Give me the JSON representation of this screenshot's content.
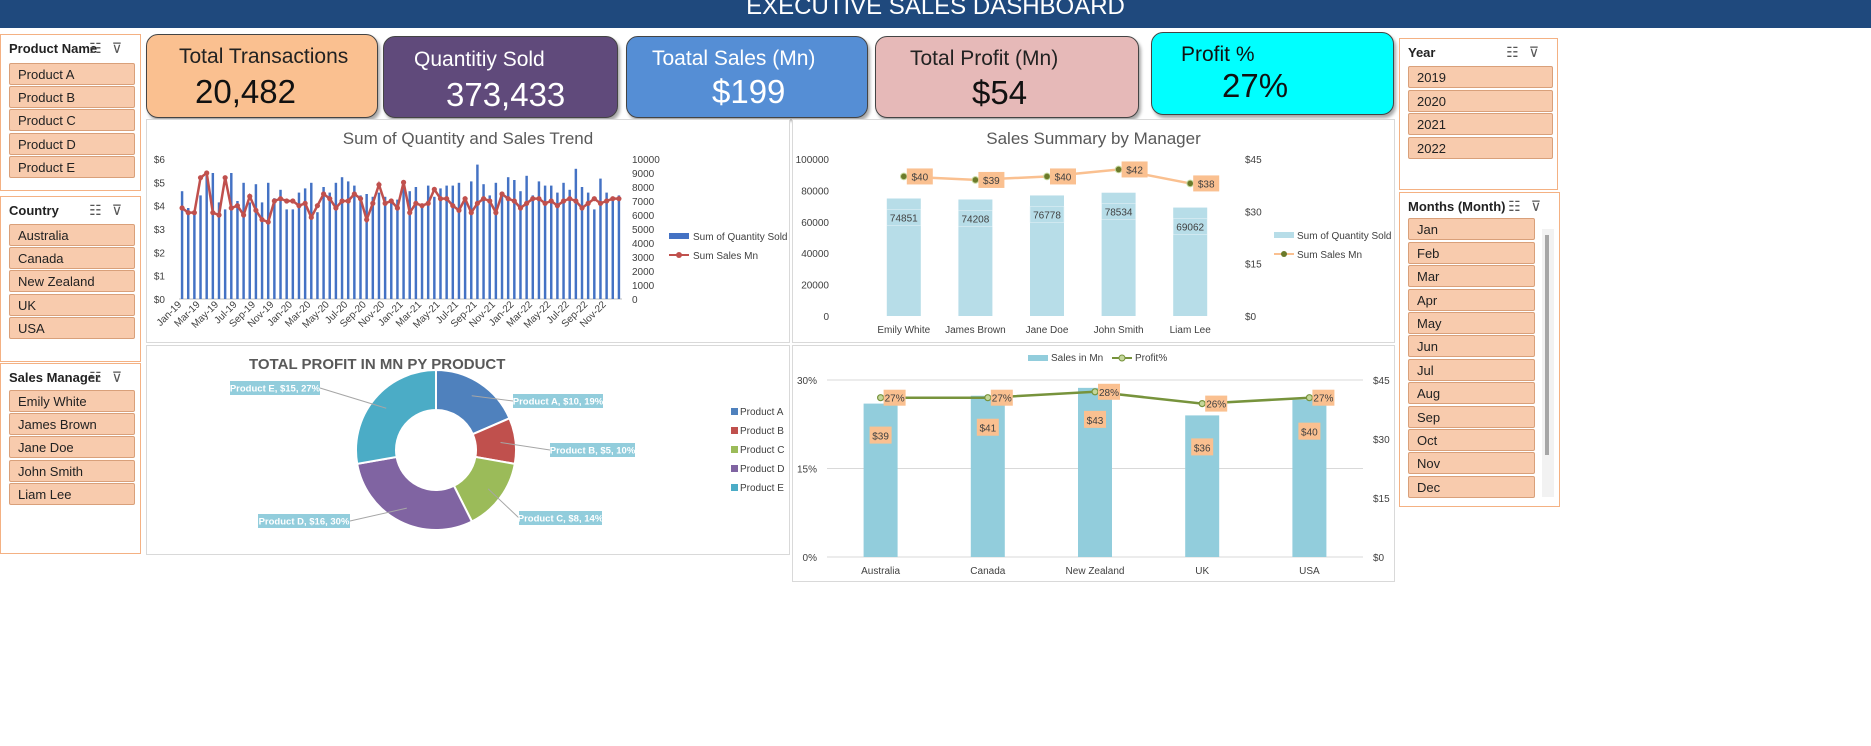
{
  "header": {
    "title": "EXECUTIVE SALES DASHBOARD"
  },
  "slicers": {
    "product": {
      "title": "Product Name",
      "items": [
        "Product A",
        "Product B",
        "Product C",
        "Product D",
        "Product E"
      ]
    },
    "country": {
      "title": "Country",
      "items": [
        "Australia",
        "Canada",
        "New Zealand",
        "UK",
        "USA"
      ]
    },
    "manager": {
      "title": "Sales Manager",
      "items": [
        "Emily White",
        "James Brown",
        "Jane Doe",
        "John Smith",
        "Liam Lee"
      ]
    },
    "year": {
      "title": "Year",
      "items": [
        "2019",
        "2020",
        "2021",
        "2022"
      ]
    },
    "month": {
      "title": "Months (Month)",
      "items": [
        "Jan",
        "Feb",
        "Mar",
        "Apr",
        "May",
        "Jun",
        "Jul",
        "Aug",
        "Sep",
        "Oct",
        "Nov",
        "Dec"
      ]
    }
  },
  "kpis": [
    {
      "label": "Total Transactions",
      "value": "20,482",
      "color": "#fac090"
    },
    {
      "label": "Quantitiy Sold",
      "value": "373,433",
      "color": "#604a7b"
    },
    {
      "label": "Toatal Sales (Mn)",
      "value": "$199",
      "color": "#558ed5"
    },
    {
      "label": "Total Profit (Mn)",
      "value": "$54",
      "color": "#e6b9b8"
    },
    {
      "label": "Profit %",
      "value": "27%",
      "color": "#00ffff"
    }
  ],
  "chart_data": [
    {
      "type": "bar",
      "title": "Sum of Quantity and Sales Trend",
      "x_tick_labels": [
        "Jan-19",
        "Mar-19",
        "May-19",
        "Jul-19",
        "Sep-19",
        "Nov-19",
        "Jan-20",
        "Mar-20",
        "May-20",
        "Jul-20",
        "Sep-20",
        "Nov-20",
        "Jan-21",
        "Mar-21",
        "May-21",
        "Jul-21",
        "Sep-21",
        "Nov-21",
        "Jan-22",
        "Mar-22",
        "May-22",
        "Jul-22",
        "Sep-22",
        "Nov-22"
      ],
      "y_left_ticks": [
        "$6",
        "$5",
        "$4",
        "$3",
        "$2",
        "$1",
        "$0"
      ],
      "y_right_ticks": [
        "10000",
        "9000",
        "8000",
        "7000",
        "6000",
        "5000",
        "4000",
        "3000",
        "2000",
        "1000",
        "0"
      ],
      "ylim_left": [
        0,
        6
      ],
      "ylim_right": [
        0,
        10000
      ],
      "series": [
        {
          "name": "Sum of Quantity Sold",
          "axis": "right",
          "color": "#4472c4",
          "values": [
            7700,
            6500,
            6300,
            7400,
            8800,
            9000,
            6900,
            6400,
            9000,
            7000,
            8300,
            6900,
            8200,
            6900,
            8300,
            7200,
            7800,
            6400,
            6400,
            7600,
            7900,
            8300,
            6200,
            8000,
            7600,
            8300,
            8700,
            8400,
            8100,
            7400,
            7500,
            7300,
            7600,
            7300,
            6900,
            7100,
            7900,
            7700,
            8000,
            6500,
            8100,
            7300,
            7900,
            8100,
            8100,
            8300,
            7300,
            8400,
            9600,
            8200,
            7400,
            8300,
            7600,
            8700,
            8500,
            7700,
            8800,
            7400,
            8400,
            8100,
            8100,
            7600,
            8300,
            7800,
            9300,
            8000,
            7600,
            6400,
            8600,
            7600,
            7000,
            7400
          ]
        },
        {
          "name": "Sum Sales Mn",
          "axis": "left",
          "color": "#c0504d",
          "values": [
            3.9,
            3.7,
            3.7,
            5.2,
            5.4,
            3.7,
            3.6,
            5.2,
            3.9,
            4.0,
            3.6,
            4.4,
            3.8,
            3.4,
            3.3,
            4.2,
            4.3,
            4.2,
            4.2,
            4.0,
            4.1,
            3.5,
            4.0,
            4.5,
            4.3,
            3.9,
            4.2,
            4.2,
            4.5,
            4.3,
            3.4,
            4.1,
            4.9,
            4.1,
            4.2,
            3.9,
            5.0,
            3.7,
            4.1,
            4.0,
            4.1,
            4.7,
            4.3,
            4.3,
            4.0,
            3.8,
            4.3,
            3.7,
            4.1,
            4.3,
            4.2,
            3.7,
            4.5,
            4.3,
            4.2,
            3.9,
            4.1,
            4.3,
            4.3,
            4.1,
            4.2,
            4.0,
            4.2,
            4.3,
            4.2,
            3.9,
            4.1,
            4.3,
            4.1,
            4.2,
            4.3,
            4.3
          ]
        }
      ],
      "legend": "right"
    },
    {
      "type": "bar",
      "title": "Sales Summary by Manager",
      "categories": [
        "Emily White",
        "James Brown",
        "Jane Doe",
        "John Smith",
        "Liam Lee"
      ],
      "y_left_ticks": [
        "100000",
        "80000",
        "60000",
        "40000",
        "20000",
        "0"
      ],
      "y_right_ticks": [
        "$45",
        "$30",
        "$15",
        "$0"
      ],
      "ylim_left": [
        0,
        100000
      ],
      "ylim_right": [
        0,
        45
      ],
      "series": [
        {
          "name": "Sum of Quantity Sold",
          "axis": "left",
          "color": "#b7dde8",
          "values": [
            74851,
            74208,
            76778,
            78534,
            69062
          ],
          "labels": [
            "74851",
            "74208",
            "76778",
            "78534",
            "69062"
          ]
        },
        {
          "name": "Sum Sales Mn",
          "axis": "right",
          "color": "#fac090",
          "values": [
            40,
            39,
            40,
            42,
            38
          ],
          "labels": [
            "$40",
            "$39",
            "$40",
            "$42",
            "$38"
          ]
        }
      ],
      "legend": "right"
    },
    {
      "type": "pie",
      "title": "TOTAL PROFIT IN MN PY PRODUCT",
      "categories": [
        "Product A",
        "Product B",
        "Product C",
        "Product D",
        "Product E"
      ],
      "values": [
        10,
        5,
        8,
        16,
        15
      ],
      "percentages": [
        19,
        10,
        14,
        30,
        27
      ],
      "labels": [
        "Product A, $10, 19%",
        "Product B, $5, 10%",
        "Product C, $8, 14%",
        "Product D, $16, 30%",
        "Product E, $15, 27%"
      ],
      "colors": [
        "#4f81bd",
        "#c0504d",
        "#9bbb59",
        "#8064a2",
        "#4bacc6"
      ],
      "legend": "right"
    },
    {
      "type": "bar",
      "title": "",
      "categories": [
        "Australia",
        "Canada",
        "New Zealand",
        "UK",
        "USA"
      ],
      "y_left_ticks": [
        "30%",
        "15%",
        "0%"
      ],
      "y_right_ticks": [
        "$45",
        "$30",
        "$15",
        "$0"
      ],
      "ylim_left": [
        0,
        0.3
      ],
      "ylim_right": [
        0,
        45
      ],
      "series": [
        {
          "name": "Sales in Mn",
          "axis": "right",
          "color": "#92cddc",
          "values": [
            39,
            41,
            43,
            36,
            40
          ],
          "labels": [
            "$39",
            "$41",
            "$43",
            "$36",
            "$40"
          ]
        },
        {
          "name": "Profit%",
          "axis": "left",
          "color": "#77933c",
          "values": [
            0.27,
            0.27,
            0.28,
            0.26,
            0.27
          ],
          "labels": [
            "27%",
            "27%",
            "28%",
            "26%",
            "27%"
          ]
        }
      ],
      "legend": "top"
    }
  ]
}
